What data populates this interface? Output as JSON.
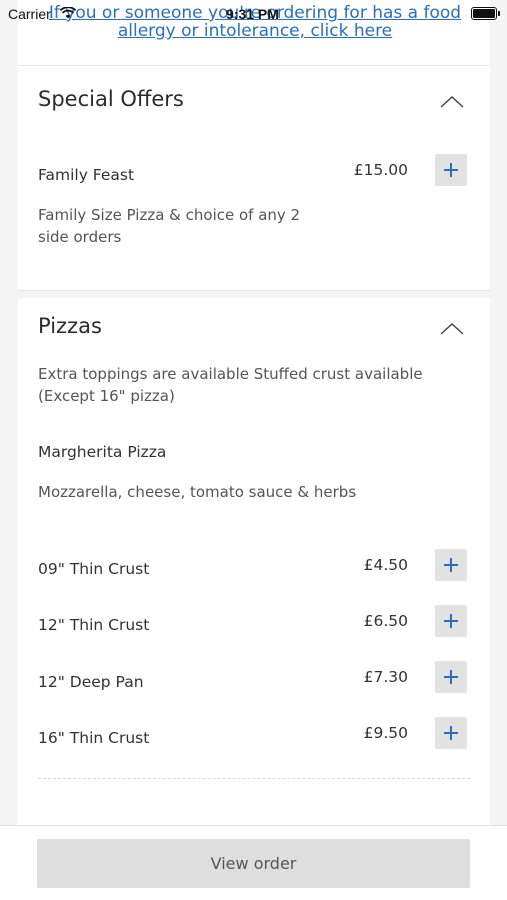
{
  "status_bar": {
    "carrier": "Carrier",
    "time": "9:31 PM"
  },
  "allergy_link": "If you or someone you're ordering for has a food allergy or intolerance, click here",
  "sections": [
    {
      "title": "Special Offers",
      "items": [
        {
          "name": "Family Feast",
          "price": "£15.00",
          "description": "Family Size Pizza & choice of any 2 side orders"
        }
      ]
    },
    {
      "title": "Pizzas",
      "description": "Extra toppings are available Stuffed crust available (Except 16\" pizza)",
      "product": {
        "name": "Margherita Pizza",
        "description": "Mozzarella, cheese, tomato sauce & herbs",
        "variants": [
          {
            "name": "09\" Thin Crust",
            "price": "£4.50"
          },
          {
            "name": "12\" Thin Crust",
            "price": "£6.50"
          },
          {
            "name": "12\" Deep Pan",
            "price": "£7.30"
          },
          {
            "name": "16\" Thin Crust",
            "price": "£9.50"
          }
        ]
      }
    }
  ],
  "peek_text": "",
  "bottom_bar": {
    "view_order_label": "View order"
  }
}
